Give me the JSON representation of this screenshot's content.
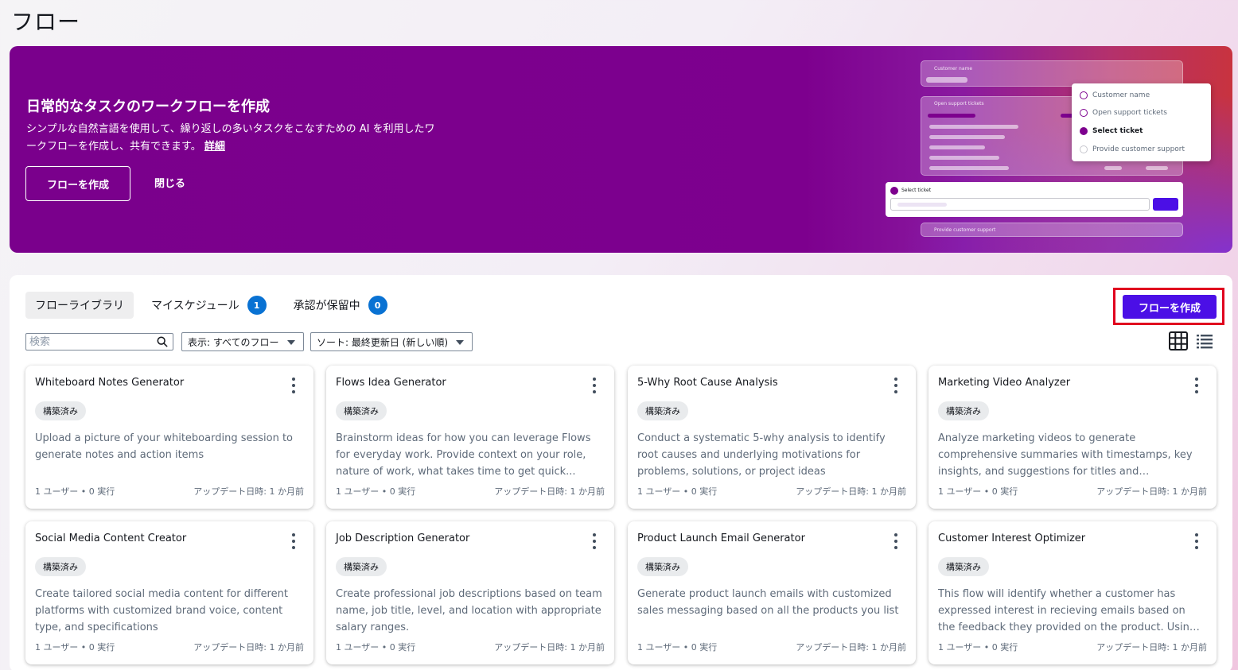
{
  "page_title": "フロー",
  "hero": {
    "title": "日常的なタスクのワークフローを作成",
    "description": "シンプルな自然言語を使用して、繰り返しの多いタスクをこなすための AI を利用したワークフローを作成し、共有できます。",
    "learn_more": "詳細",
    "create_label": "フローを作成",
    "close_label": "閉じる",
    "illustration": {
      "customer_name_label": "Customer name",
      "open_tickets_label": "Open support tickets",
      "select_ticket_label": "Select ticket",
      "provide_support_label": "Provide customer support",
      "popup_items": [
        "Customer name",
        "Open support tickets",
        "Select ticket",
        "Provide customer support"
      ]
    }
  },
  "tabs": [
    {
      "label": "フローライブラリ",
      "active": true
    },
    {
      "label": "マイスケジュール",
      "badge": "1"
    },
    {
      "label": "承認が保留中",
      "badge": "0"
    }
  ],
  "create_button": "フローを作成",
  "search": {
    "placeholder": "検索"
  },
  "filter_dropdown": "表示: すべてのフロー",
  "sort_dropdown": "ソート: 最終更新日 (新しい順)",
  "cards": [
    {
      "title": "Whiteboard Notes Generator",
      "badge": "構築済み",
      "description": "Upload a picture of your whiteboarding session to generate notes and action items",
      "meta": "1 ユーザー • 0 実行",
      "updated": "アップデート日時: 1 か月前"
    },
    {
      "title": "Flows Idea Generator",
      "badge": "構築済み",
      "description": "Brainstorm ideas for how you can leverage Flows for everyday work. Provide context on your role, nature of work, what takes time to get quick...",
      "meta": "1 ユーザー • 0 実行",
      "updated": "アップデート日時: 1 か月前"
    },
    {
      "title": "5-Why Root Cause Analysis",
      "badge": "構築済み",
      "description": "Conduct a systematic 5-why analysis to identify root causes and underlying motivations for problems, solutions, or project ideas",
      "meta": "1 ユーザー • 0 実行",
      "updated": "アップデート日時: 1 か月前"
    },
    {
      "title": "Marketing Video Analyzer",
      "badge": "構築済み",
      "description": "Analyze marketing videos to generate comprehensive summaries with timestamps, key insights, and suggestions for titles and descriptions.",
      "meta": "1 ユーザー • 0 実行",
      "updated": "アップデート日時: 1 か月前"
    },
    {
      "title": "Social Media Content Creator",
      "badge": "構築済み",
      "description": "Create tailored social media content for different platforms with customized brand voice, content type, and specifications",
      "meta": "1 ユーザー • 0 実行",
      "updated": "アップデート日時: 1 か月前"
    },
    {
      "title": "Job Description Generator",
      "badge": "構築済み",
      "description": "Create professional job descriptions based on team name, job title, level, and location with appropriate salary ranges.",
      "meta": "1 ユーザー • 0 実行",
      "updated": "アップデート日時: 1 か月前"
    },
    {
      "title": "Product Launch Email Generator",
      "badge": "構築済み",
      "description": "Generate product launch emails with customized sales messaging based on all the products you list",
      "meta": "1 ユーザー • 0 実行",
      "updated": "アップデート日時: 1 か月前"
    },
    {
      "title": "Customer Interest Optimizer",
      "badge": "構築済み",
      "description": "This flow will identify whether a customer has expressed interest in recieving emails based on the feedback they provided on the product. Using the...",
      "meta": "1 ユーザー • 0 実行",
      "updated": "アップデート日時: 1 か月前"
    }
  ],
  "colors": {
    "hero_bg": "#7d008e",
    "primary_button": "#4b0fe6",
    "badge_blue": "#0972d3",
    "highlight_border": "#e0001e"
  }
}
